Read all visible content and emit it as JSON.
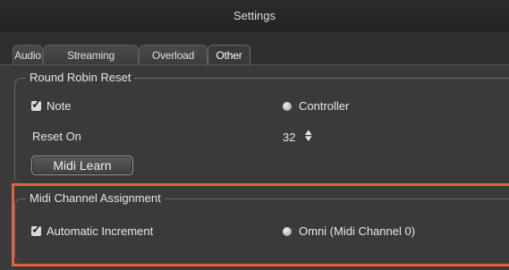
{
  "window": {
    "title": "Settings"
  },
  "tabs": [
    {
      "label": "Audio",
      "active": false
    },
    {
      "label": "Streaming",
      "active": false
    },
    {
      "label": "Overload",
      "active": false
    },
    {
      "label": "Other",
      "active": true
    }
  ],
  "round_robin": {
    "title": "Round Robin Reset",
    "note_label": "Note",
    "note_checked": true,
    "controller_label": "Controller",
    "reset_on_label": "Reset On",
    "reset_on_value": "32",
    "midi_learn_label": "Midi Learn"
  },
  "midi_channel": {
    "title": "Midi Channel Assignment",
    "auto_increment_label": "Automatic Increment",
    "auto_increment_checked": true,
    "omni_label": "Omni (Midi Channel 0)"
  },
  "colors": {
    "highlight": "#e06048",
    "background": "#3a3a3a"
  }
}
